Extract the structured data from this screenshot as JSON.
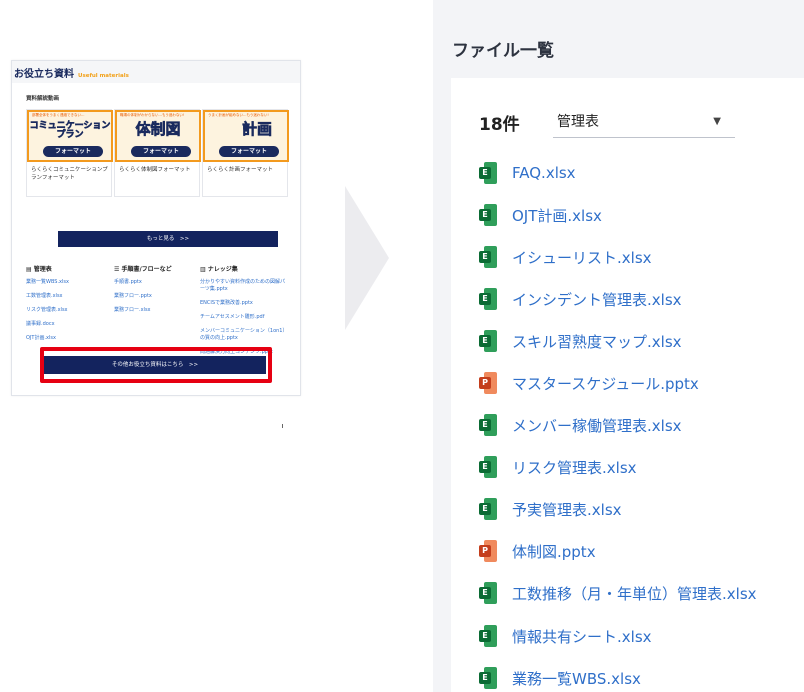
{
  "thumbnail": {
    "title": "お役立ち資料",
    "subtitle": "Useful materials",
    "video_section": "資料解説動画",
    "videos": [
      {
        "top_text": "部署全体をうまく連絡できない…",
        "big_text": "コミュニケーション\nプラン",
        "format_text": "フォーマット",
        "label": "らくらくコミュニケーションプランフォーマット"
      },
      {
        "top_text": "職場の体制がわからない…もう迷わない!",
        "big_text": "体制図",
        "format_text": "フォーマット",
        "label": "らくらく体制図フォーマット"
      },
      {
        "top_text": "うまく計画が組めない…もう迷わない!",
        "big_text": "計画",
        "format_text": "フォーマット",
        "label": "らくらく計画フォーマット"
      }
    ],
    "more_button": "もっと見る　>>",
    "columns": [
      {
        "icon": "document-icon",
        "title": "管理表",
        "items": [
          "業務一覧WBS.xlsx",
          "工数管理表.xlsx",
          "リスク管理表.xlsx",
          "議事録.docx",
          "OJT計画.xlsx"
        ]
      },
      {
        "icon": "list-icon",
        "title": "手順書/フローなど",
        "items": [
          "手順書.pptx",
          "業務フロー.pptx",
          "業務フロー.xlsx"
        ]
      },
      {
        "icon": "book-icon",
        "title": "ナレッジ集",
        "items": [
          "分かりやすい資料作成のための図解パーツ集.pptx",
          "ENCISで業務改善.pptx",
          "チームアセスメント雛形.pdf",
          "メンバーコミュニケーション（1on1）の質の向上.pptx",
          "問題解決力向上コンテンツ.pptx"
        ]
      }
    ],
    "other_button": "その他お役立ち資料はこちら　>>"
  },
  "panel": {
    "title": "ファイル一覧",
    "count": "18件",
    "filter_value": "管理表",
    "caret": "▼",
    "files": [
      {
        "name": "FAQ.xlsx",
        "type": "xlsx",
        "badge": "E"
      },
      {
        "name": "OJT計画.xlsx",
        "type": "xlsx",
        "badge": "E"
      },
      {
        "name": "イシューリスト.xlsx",
        "type": "xlsx",
        "badge": "E"
      },
      {
        "name": "インシデント管理表.xlsx",
        "type": "xlsx",
        "badge": "E"
      },
      {
        "name": "スキル習熟度マップ.xlsx",
        "type": "xlsx",
        "badge": "E"
      },
      {
        "name": "マスタースケジュール.pptx",
        "type": "pptx",
        "badge": "P"
      },
      {
        "name": "メンバー稼働管理表.xlsx",
        "type": "xlsx",
        "badge": "E"
      },
      {
        "name": "リスク管理表.xlsx",
        "type": "xlsx",
        "badge": "E"
      },
      {
        "name": "予実管理表.xlsx",
        "type": "xlsx",
        "badge": "E"
      },
      {
        "name": "体制図.pptx",
        "type": "pptx",
        "badge": "P"
      },
      {
        "name": "工数推移（月・年単位）管理表.xlsx",
        "type": "xlsx",
        "badge": "E"
      },
      {
        "name": "情報共有シート.xlsx",
        "type": "xlsx",
        "badge": "E"
      },
      {
        "name": "業務一覧WBS.xlsx",
        "type": "xlsx",
        "badge": "E"
      }
    ]
  }
}
